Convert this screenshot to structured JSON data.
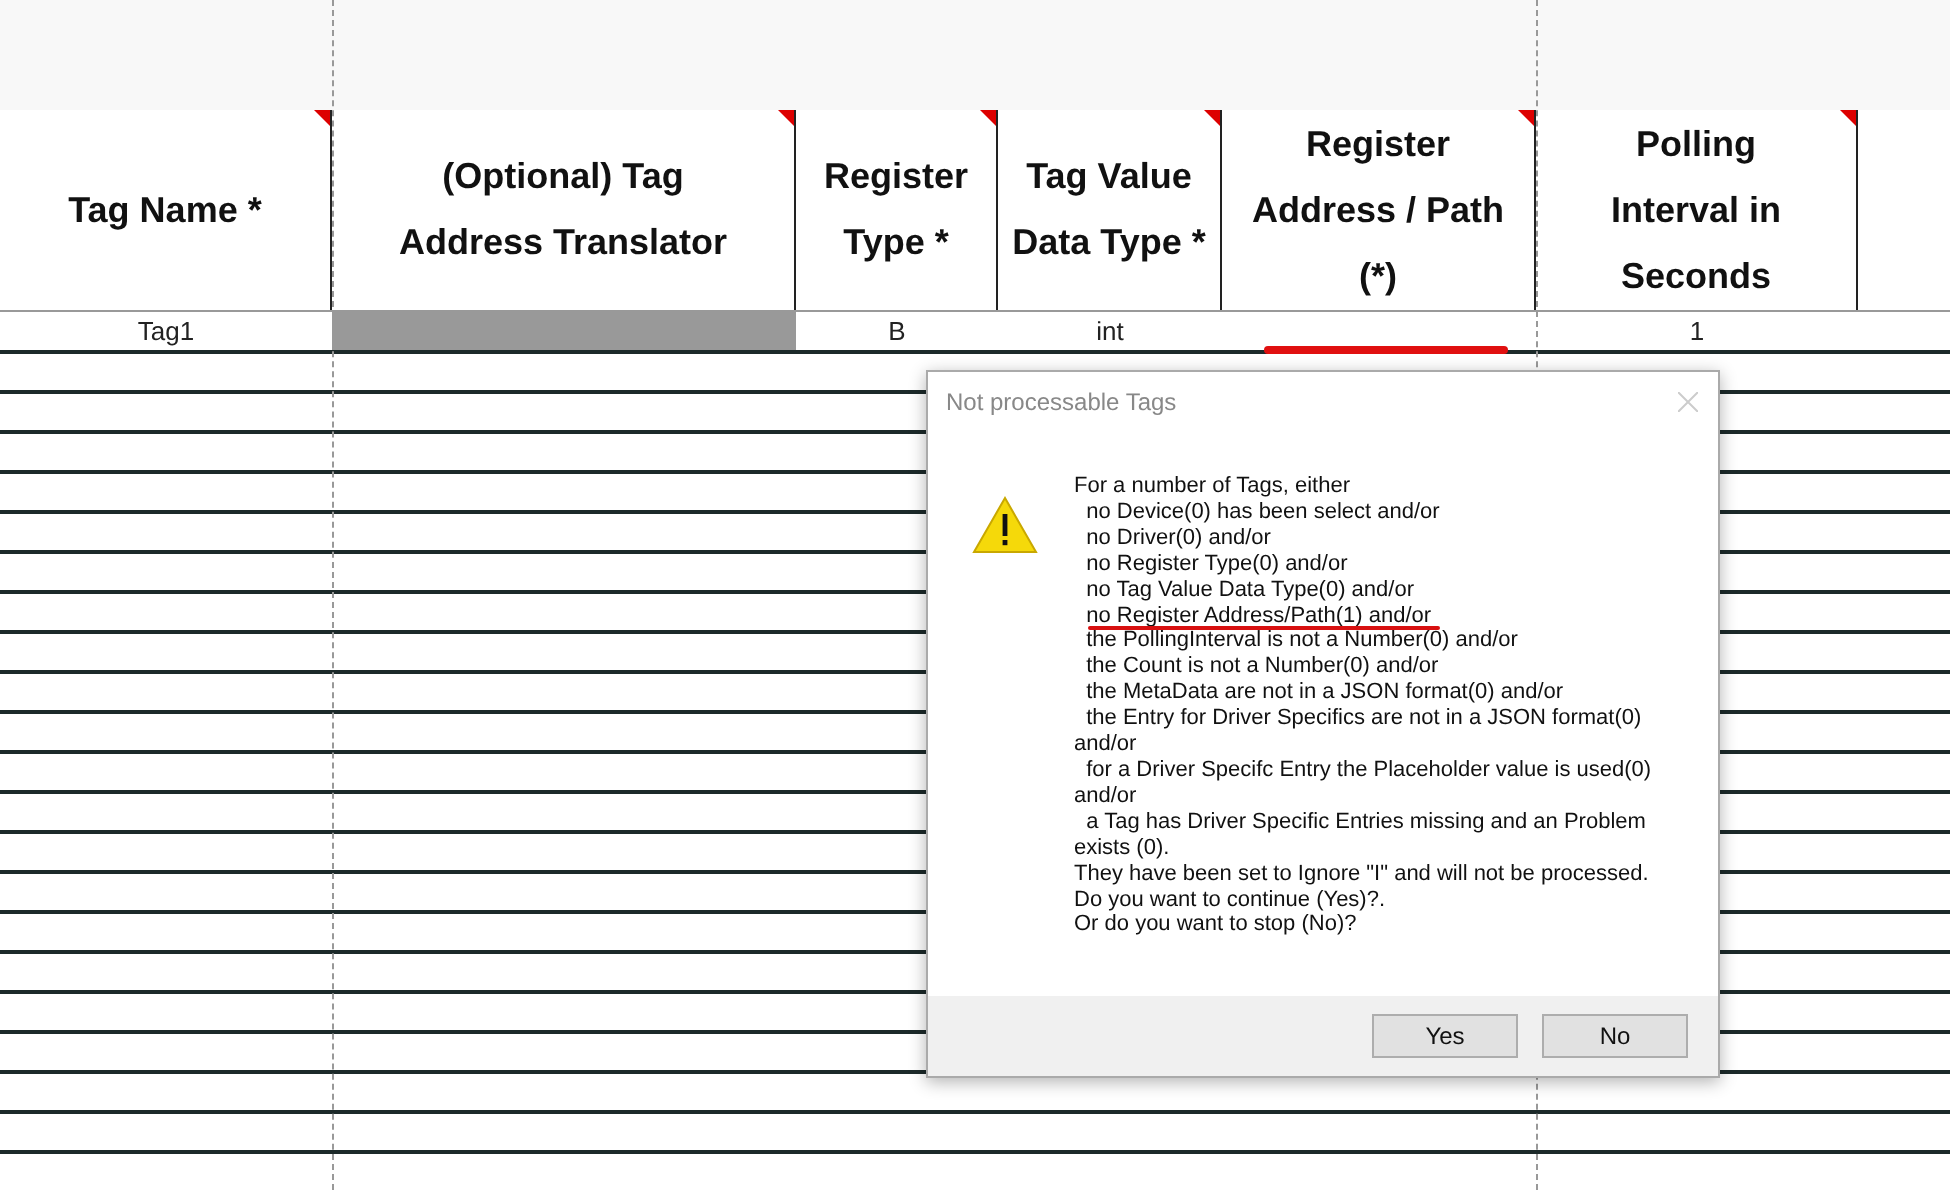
{
  "table": {
    "columns": [
      {
        "label": "Tag Name *",
        "commented": true
      },
      {
        "label": "(Optional) Tag Address Translator",
        "commented": true
      },
      {
        "label": "Register Type *",
        "commented": true
      },
      {
        "label": "Tag Value Data Type *",
        "commented": true
      },
      {
        "label": "Register Address / Path (*)",
        "commented": true
      },
      {
        "label": "Polling Interval in Seconds",
        "commented": true
      }
    ],
    "rows": [
      [
        {
          "text": "Tag1",
          "disabled": false,
          "highlighted": false
        },
        {
          "disabled": true,
          "highlighted": false
        },
        {
          "text": "B",
          "disabled": false,
          "highlighted": false
        },
        {
          "text": "int",
          "disabled": false,
          "highlighted": false
        },
        {
          "disabled": false,
          "highlighted": true
        },
        {
          "text": "1",
          "disabled": false,
          "highlighted": false
        }
      ]
    ]
  },
  "dialog": {
    "title": "Not processable Tags",
    "lines": [
      {
        "text": "For a number of Tags, either",
        "highlighted": false
      },
      {
        "text": "  no Device(0) has been select and/or",
        "highlighted": false
      },
      {
        "text": "  no Driver(0) and/or",
        "highlighted": false
      },
      {
        "text": "  no Register Type(0) and/or",
        "highlighted": false
      },
      {
        "text": "  no Tag Value Data Type(0) and/or",
        "highlighted": false
      },
      {
        "text": "  no Register Address/Path(1) and/or",
        "highlighted": true
      },
      {
        "text": "  the PollingInterval is not a Number(0) and/or",
        "highlighted": false
      },
      {
        "text": "  the Count is not a Number(0) and/or",
        "highlighted": false
      },
      {
        "text": "  the MetaData are not in a JSON format(0) and/or",
        "highlighted": false
      },
      {
        "text": "  the Entry for Driver Specifics are not in a JSON format(0)",
        "highlighted": false
      },
      {
        "text": "and/or",
        "highlighted": false
      },
      {
        "text": "  for a Driver Specifc Entry the Placeholder value is used(0)",
        "highlighted": false
      },
      {
        "text": "and/or",
        "highlighted": false
      },
      {
        "text": "  a Tag has Driver Specific Entries missing and an Problem",
        "highlighted": false
      },
      {
        "text": "exists (0).",
        "highlighted": false
      },
      {
        "text": "They have been set to Ignore \"I\" and will not be processed.",
        "highlighted": false
      },
      {
        "text": "Do you want to continue (Yes)?.",
        "highlighted": false
      },
      {
        "text": "Or do you want to stop (No)?",
        "highlighted": false
      }
    ],
    "buttons": [
      "Yes",
      "No"
    ]
  }
}
